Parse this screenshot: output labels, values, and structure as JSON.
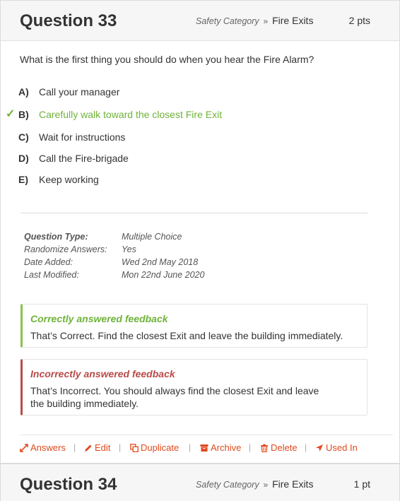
{
  "questions": [
    {
      "title": "Question 33",
      "category": "Safety Category",
      "separator": "»",
      "subcategory": "Fire Exits",
      "points": "2 pts"
    },
    {
      "title": "Question 34",
      "category": "Safety Category",
      "separator": "»",
      "subcategory": "Fire Exits",
      "points": "1 pt"
    }
  ],
  "question_text": "What is the first thing you should do when you hear the Fire Alarm?",
  "answers": [
    {
      "letter": "A)",
      "text": "Call your manager",
      "correct": false
    },
    {
      "letter": "B)",
      "text": "Carefully walk toward the closest Fire Exit",
      "correct": true
    },
    {
      "letter": "C)",
      "text": "Wait for instructions",
      "correct": false
    },
    {
      "letter": "D)",
      "text": "Call the Fire-brigade",
      "correct": false
    },
    {
      "letter": "E)",
      "text": "Keep working",
      "correct": false
    }
  ],
  "check_glyph": "✓",
  "meta": [
    {
      "key": "Question Type:",
      "value": "Multiple Choice"
    },
    {
      "key": "Randomize Answers:",
      "value": "Yes"
    },
    {
      "key": "Date Added:",
      "value": "Wed 2nd May 2018"
    },
    {
      "key": "Last Modified:",
      "value": "Mon 22nd June 2020"
    }
  ],
  "feedback": {
    "correct": {
      "title": "Correctly answered feedback",
      "body": "That’s Correct. Find the closest Exit and leave the building immediately."
    },
    "incorrect": {
      "title": "Incorrectly answered feedback",
      "body": "That’s Incorrect. You should always find the closest Exit and leave the building immediately."
    }
  },
  "actions": [
    {
      "label": "Answers",
      "icon": "expand-icon"
    },
    {
      "label": "Edit",
      "icon": "pencil-icon"
    },
    {
      "label": "Duplicate",
      "icon": "duplicate-icon"
    },
    {
      "label": "Archive",
      "icon": "archive-icon"
    },
    {
      "label": "Delete",
      "icon": "trash-icon"
    },
    {
      "label": "Used In",
      "icon": "location-arrow-icon"
    }
  ],
  "action_separator": "|",
  "colors": {
    "correct": "#6fb33a",
    "incorrect": "#b94a48",
    "action": "#e0491d"
  }
}
